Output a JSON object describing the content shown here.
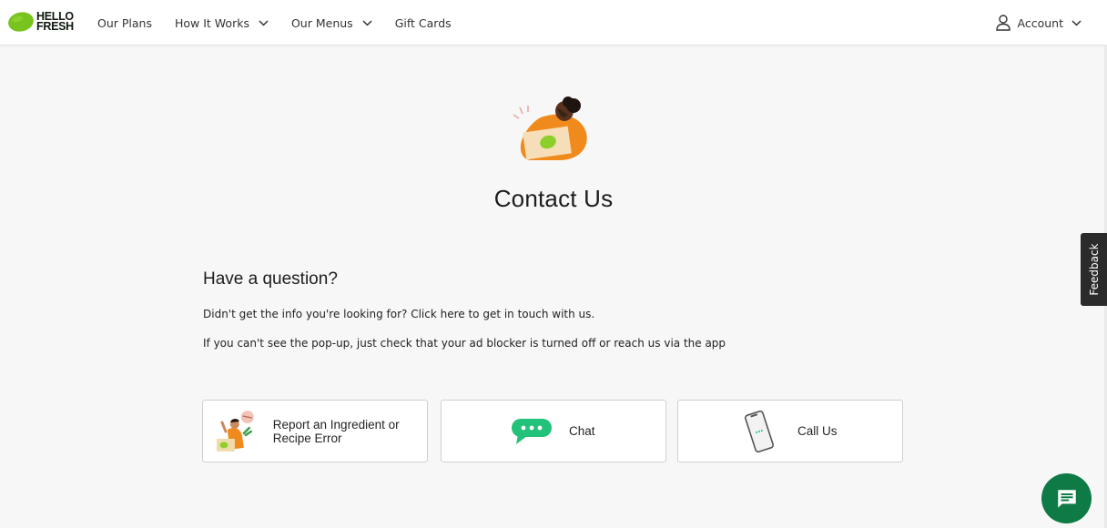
{
  "header": {
    "logo": {
      "line1": "HELLO",
      "line2": "FRESH"
    },
    "nav": [
      {
        "label": "Our Plans",
        "has_dropdown": false
      },
      {
        "label": "How It Works",
        "has_dropdown": true
      },
      {
        "label": "Our Menus",
        "has_dropdown": true
      },
      {
        "label": "Gift Cards",
        "has_dropdown": false
      }
    ],
    "account": {
      "label": "Account",
      "icon": "user-icon"
    }
  },
  "page": {
    "title": "Contact Us",
    "section_heading": "Have a question?",
    "paragraphs": [
      "Didn't get the info you're looking for? Click here to get in touch with us.",
      "If you can't see the pop-up, just check that your ad blocker is turned off or reach us via the app"
    ]
  },
  "contact_options": [
    {
      "label": "Report an Ingredient or Recipe Error",
      "icon": "chef-illustration-icon"
    },
    {
      "label": "Chat",
      "icon": "chat-bubble-icon"
    },
    {
      "label": "Call Us",
      "icon": "phone-icon"
    }
  ],
  "feedback_tab": {
    "label": "Feedback"
  },
  "colors": {
    "brand_green": "#91c11e",
    "chat_green": "#22c27a",
    "fab_green": "#0e7a45",
    "orange": "#f08a1c",
    "background": "#f7f7f7"
  }
}
